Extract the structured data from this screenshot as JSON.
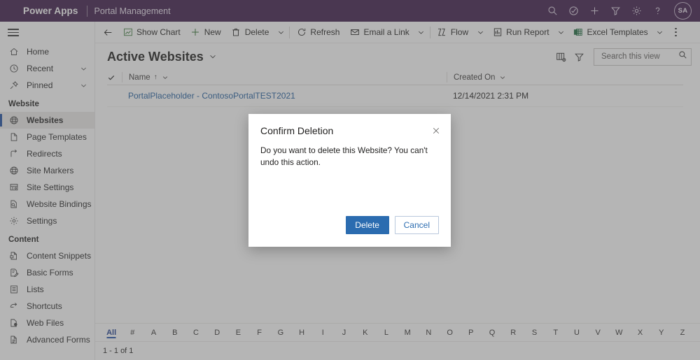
{
  "brand": {
    "title": "Power Apps",
    "app_name": "Portal Management",
    "avatar_initials": "SA",
    "icons": [
      {
        "name": "search-icon"
      },
      {
        "name": "diagnostics-icon"
      },
      {
        "name": "plus-icon"
      },
      {
        "name": "filter-icon"
      },
      {
        "name": "gear-icon"
      },
      {
        "name": "help-icon"
      }
    ]
  },
  "sidebar": {
    "top_items": [
      {
        "label": "Home",
        "icon": "home-icon",
        "chevron": false
      },
      {
        "label": "Recent",
        "icon": "clock-icon",
        "chevron": true
      },
      {
        "label": "Pinned",
        "icon": "pin-icon",
        "chevron": true
      }
    ],
    "groups": [
      {
        "title": "Website",
        "items": [
          {
            "label": "Websites",
            "icon": "globe-icon",
            "selected": true
          },
          {
            "label": "Page Templates",
            "icon": "page-icon",
            "selected": false
          },
          {
            "label": "Redirects",
            "icon": "redirect-icon",
            "selected": false
          },
          {
            "label": "Site Markers",
            "icon": "globe-icon",
            "selected": false
          },
          {
            "label": "Site Settings",
            "icon": "site-settings-icon",
            "selected": false
          },
          {
            "label": "Website Bindings",
            "icon": "binding-icon",
            "selected": false
          },
          {
            "label": "Settings",
            "icon": "gear-icon",
            "selected": false
          }
        ]
      },
      {
        "title": "Content",
        "items": [
          {
            "label": "Content Snippets",
            "icon": "snippet-icon",
            "selected": false
          },
          {
            "label": "Basic Forms",
            "icon": "form-icon",
            "selected": false
          },
          {
            "label": "Lists",
            "icon": "list-icon",
            "selected": false
          },
          {
            "label": "Shortcuts",
            "icon": "shortcut-icon",
            "selected": false
          },
          {
            "label": "Web Files",
            "icon": "webfile-icon",
            "selected": false
          },
          {
            "label": "Advanced Forms",
            "icon": "advanced-form-icon",
            "selected": false
          }
        ]
      }
    ]
  },
  "commandbar": {
    "back": "back-arrow-icon",
    "buttons": [
      {
        "label": "Show Chart",
        "icon": "chart-icon",
        "caret": false,
        "divider_after": false
      },
      {
        "label": "New",
        "icon": "plus-icon",
        "caret": false,
        "divider_after": false
      },
      {
        "label": "Delete",
        "icon": "trash-icon",
        "caret": true,
        "divider_after": true
      },
      {
        "label": "Refresh",
        "icon": "refresh-icon",
        "caret": false,
        "divider_after": false
      },
      {
        "label": "Email a Link",
        "icon": "email-icon",
        "caret": true,
        "divider_after": true
      },
      {
        "label": "Flow",
        "icon": "flow-icon",
        "caret": true,
        "divider_after": false
      },
      {
        "label": "Run Report",
        "icon": "report-icon",
        "caret": true,
        "divider_after": false
      },
      {
        "label": "Excel Templates",
        "icon": "excel-icon",
        "caret": true,
        "divider_after": false
      }
    ],
    "overflow": "more-options-icon"
  },
  "view": {
    "title": "Active Websites",
    "title_caret": "chevron-down-icon",
    "edit_columns_icon": "edit-columns-icon",
    "edit_filters_icon": "edit-filters-icon"
  },
  "search": {
    "placeholder": "Search this view",
    "value": "",
    "icon": "search-icon"
  },
  "grid": {
    "columns": [
      {
        "label": "Name",
        "sort": "↑"
      },
      {
        "label": "Created On",
        "sort": ""
      }
    ],
    "rows": [
      {
        "name": "PortalPlaceholder - ContosoPortalTEST2021",
        "created_on": "12/14/2021 2:31 PM"
      }
    ]
  },
  "alphabar": {
    "items": [
      "All",
      "#",
      "A",
      "B",
      "C",
      "D",
      "E",
      "F",
      "G",
      "H",
      "I",
      "J",
      "K",
      "L",
      "M",
      "N",
      "O",
      "P",
      "Q",
      "R",
      "S",
      "T",
      "U",
      "V",
      "W",
      "X",
      "Y",
      "Z"
    ],
    "active": "All"
  },
  "statusbar": {
    "record_count": "1 - 1 of 1"
  },
  "dialog": {
    "title": "Confirm Deletion",
    "close_icon": "close-icon",
    "message": "Do you want to delete this Website? You can't undo this action.",
    "primary_button": "Delete",
    "secondary_button": "Cancel"
  },
  "colors": {
    "brand_bar": "#3d1a4a",
    "primary_button": "#2b6cb0",
    "link": "#1f5d9e",
    "selection_indicator": "#1e4fa3"
  }
}
